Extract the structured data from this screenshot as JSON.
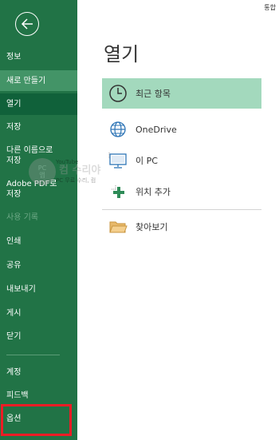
{
  "header": {
    "top_right_label": "통합"
  },
  "sidebar": {
    "items": [
      {
        "label": "정보"
      },
      {
        "label": "새로 만들기"
      },
      {
        "label": "열기"
      },
      {
        "label": "저장"
      },
      {
        "label": "다른 이름으로\n저장"
      },
      {
        "label": "Adobe PDF로\n저장"
      },
      {
        "label": "사용 기록"
      },
      {
        "label": "인쇄"
      },
      {
        "label": "공유"
      },
      {
        "label": "내보내기"
      },
      {
        "label": "게시"
      },
      {
        "label": "닫기"
      },
      {
        "label": "계정"
      },
      {
        "label": "피드백"
      },
      {
        "label": "옵션"
      }
    ]
  },
  "main": {
    "title": "열기",
    "locations": [
      {
        "label": "최근 항목",
        "icon": "clock-icon"
      },
      {
        "label": "OneDrive",
        "icon": "globe-icon"
      },
      {
        "label": "이 PC",
        "icon": "computer-icon"
      },
      {
        "label": "위치 추가",
        "icon": "add-location-icon"
      },
      {
        "label": "찾아보기",
        "icon": "folder-icon"
      }
    ]
  },
  "watermark": {
    "badge": "PC\n앱",
    "line1": "YouTube",
    "line2": "컴 수리야",
    "line3": "PC 무료 수리, 컴"
  },
  "colors": {
    "sidebar": "#217346",
    "sidebar_active": "#10613a",
    "selected_location": "#a3d9bd",
    "highlight": "#ee1c25"
  }
}
